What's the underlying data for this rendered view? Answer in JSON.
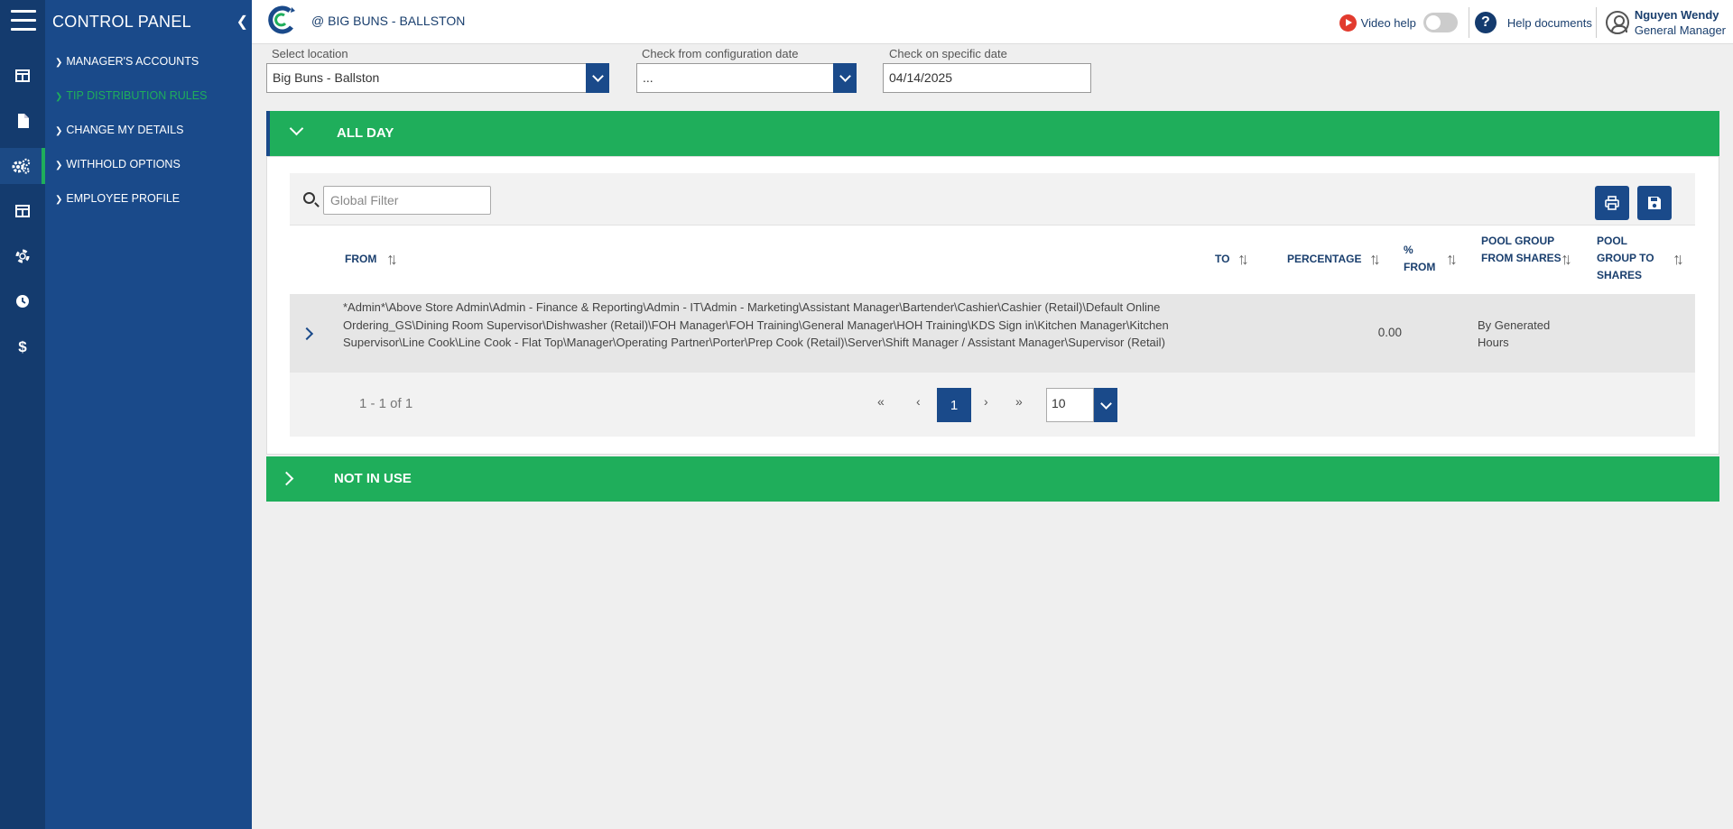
{
  "sidebar": {
    "title": "CONTROL PANEL",
    "items": [
      {
        "label": "MANAGER'S ACCOUNTS",
        "active": false
      },
      {
        "label": "TIP DISTRIBUTION RULES",
        "active": true
      },
      {
        "label": "CHANGE MY DETAILS",
        "active": false
      },
      {
        "label": "WITHHOLD OPTIONS",
        "active": false
      },
      {
        "label": "EMPLOYEE PROFILE",
        "active": false
      }
    ],
    "rail_icons": [
      "dashboard-icon",
      "document-icon",
      "gears-icon",
      "schedule-icon",
      "support-icon",
      "clock-icon",
      "dollar-icon"
    ]
  },
  "header": {
    "store": "@ BIG BUNS - BALLSTON",
    "video_help": "Video help",
    "help_docs": "Help documents",
    "user_name": "Nguyen Wendy",
    "user_role": "General Manager"
  },
  "filters": {
    "location_label": "Select location",
    "location_value": "Big Buns - Ballston",
    "config_date_label": "Check from configuration date",
    "config_date_value": "...",
    "specific_date_label": "Check on specific date",
    "specific_date_value": "04/14/2025"
  },
  "panels": {
    "all_day": "ALL DAY",
    "not_in_use": "NOT IN USE"
  },
  "table": {
    "filter_placeholder": "Global Filter",
    "headers": {
      "from": "FROM",
      "to": "TO",
      "percentage": "PERCENTAGE",
      "pct_from": "% FROM",
      "pool_from": "POOL GROUP FROM SHARES",
      "pool_to": "POOL GROUP TO SHARES"
    },
    "rows": [
      {
        "from": "*Admin*\\Above Store Admin\\Admin - Finance & Reporting\\Admin - IT\\Admin - Marketing\\Assistant Manager\\Bartender\\Cashier\\Cashier (Retail)\\Default Online Ordering_GS\\Dining Room Supervisor\\Dishwasher (Retail)\\FOH Manager\\FOH Training\\General Manager\\HOH Training\\KDS Sign in\\Kitchen Manager\\Kitchen Supervisor\\Line Cook\\Line Cook - Flat Top\\Manager\\Operating Partner\\Porter\\Prep Cook (Retail)\\Server\\Shift Manager / Assistant Manager\\Supervisor (Retail)",
        "to": "",
        "percentage": "0.00",
        "pct_from": "",
        "pool_from": "By Generated Hours",
        "pool_to": ""
      }
    ],
    "pager": {
      "report": "1 - 1 of 1",
      "current_page": "1",
      "page_size": "10"
    }
  },
  "colors": {
    "navy": "#143b6e",
    "menu_blue": "#1a4a8a",
    "green": "#1fae5b",
    "red": "#e23b2e"
  }
}
